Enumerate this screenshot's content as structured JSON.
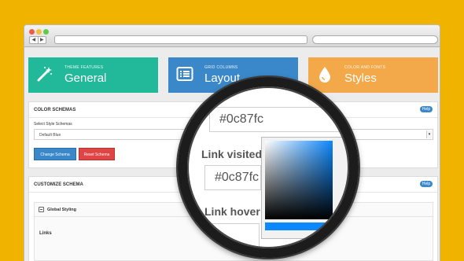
{
  "tiles": [
    {
      "small": "Theme Features",
      "big": "General",
      "color": "#22b89a",
      "icon": "magic-wand-icon"
    },
    {
      "small": "Grid Columns",
      "big": "Layout",
      "color": "#3a88c9",
      "icon": "list-layout-icon"
    },
    {
      "small": "Color and Fonts",
      "big": "Styles",
      "color": "#f3a94a",
      "icon": "paint-drop-icon"
    }
  ],
  "schemas": {
    "title": "COLOR SCHEMAS",
    "help": "Help",
    "select_label": "Select Style Schemas",
    "select_value": "Default Blue",
    "change_button": "Change Schema",
    "reset_button": "Reset Schema"
  },
  "customize": {
    "title": "CUSTOMIZE SCHEMA",
    "help": "Help",
    "group_title": "Global Styling",
    "links_label": "Links"
  },
  "magnifier": {
    "top_value": "#0c87fc",
    "visited_label": "Link visited",
    "visited_value": "#0c87fc",
    "hover_label": "Link hover",
    "picker_color": "#0c87fc"
  },
  "colors": {
    "background": "#f0b400",
    "primary": "#3a88c9",
    "danger": "#e04545"
  }
}
